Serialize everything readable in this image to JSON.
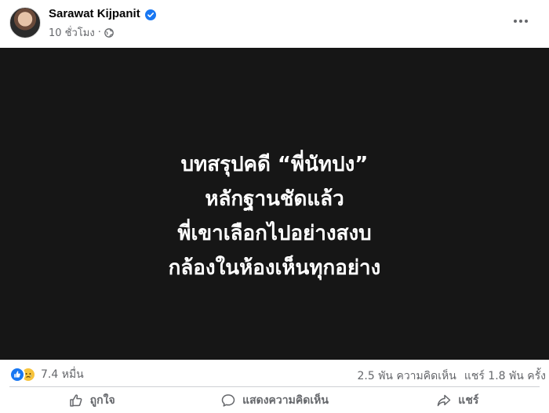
{
  "post": {
    "author": "Sarawat Kijpanit",
    "time": "10 ชั่วโมง",
    "separator": "·"
  },
  "media": {
    "lines": [
      "บทสรุปคดี “พี่นัทปง”",
      "หลักฐานชัดแล้ว",
      "พี่เขาเลือกไปอย่างสงบ",
      "กล้องในห้องเห็นทุกอย่าง"
    ]
  },
  "stats": {
    "reactions": "7.4 หมื่น",
    "comments": "2.5 พัน ความคิดเห็น",
    "shares": "แชร์ 1.8 พัน ครั้ง"
  },
  "actions": {
    "like": "ถูกใจ",
    "comment": "แสดงความคิดเห็น",
    "share": "แชร์"
  },
  "colors": {
    "brand": "#1877f2",
    "muted": "#65676b",
    "media_bg": "#161616"
  },
  "icons": [
    "avatar",
    "verified-badge-icon",
    "globe-icon",
    "more-icon",
    "like-reaction-icon",
    "sad-reaction-icon",
    "like-icon",
    "comment-icon",
    "share-icon"
  ]
}
